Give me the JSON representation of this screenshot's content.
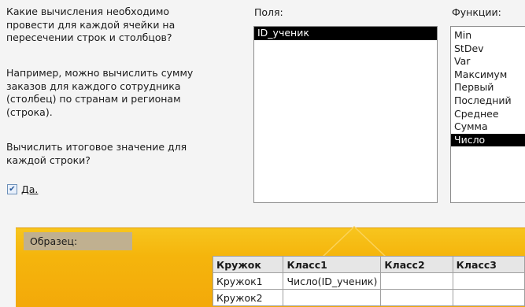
{
  "left_panel": {
    "question": "Какие вычисления необходимо провести для каждой ячейки на пересечении строк и столбцов?",
    "example": "Например, можно вычислить сумму заказов для каждого сотрудника (столбец) по странам и регионам (строка).",
    "summary_prompt": "Вычислить итоговое значение для каждой строки?",
    "checkbox_label": "Да.",
    "checkbox_checked": true
  },
  "fields": {
    "title": "Поля:",
    "items": [
      "ID_ученик"
    ],
    "selected_index": 0
  },
  "functions": {
    "title": "Функции:",
    "items": [
      "Min",
      "StDev",
      "Var",
      "Максимум",
      "Первый",
      "Последний",
      "Среднее",
      "Сумма",
      "Число"
    ],
    "selected": "Число"
  },
  "sample": {
    "label": "Образец:",
    "headers": [
      "Кружок",
      "Класс1",
      "Класс2",
      "Класс3"
    ],
    "rows": [
      [
        "Кружок1",
        "Число(ID_ученик)",
        "",
        ""
      ],
      [
        "Кружок2",
        "",
        "",
        ""
      ]
    ]
  },
  "colors": {
    "accent_yellow": "#f5b50c",
    "selection": "#000000"
  }
}
